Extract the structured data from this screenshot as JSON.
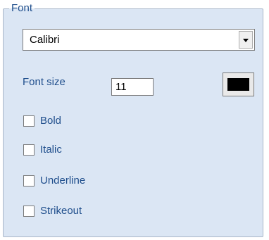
{
  "group": {
    "title": "Font"
  },
  "font_family": {
    "selected": "Calibri",
    "dropdown_icon": "chevron-down-icon"
  },
  "font_size": {
    "label": "Font size",
    "value": "11"
  },
  "color_picker": {
    "color": "#000000"
  },
  "options": [
    {
      "label": "Bold",
      "checked": false
    },
    {
      "label": "Italic",
      "checked": false
    },
    {
      "label": "Underline",
      "checked": false
    },
    {
      "label": "Strikeout",
      "checked": false
    }
  ],
  "colors": {
    "group_background": "#dbe6f4",
    "label_text": "#1f4e8c"
  }
}
